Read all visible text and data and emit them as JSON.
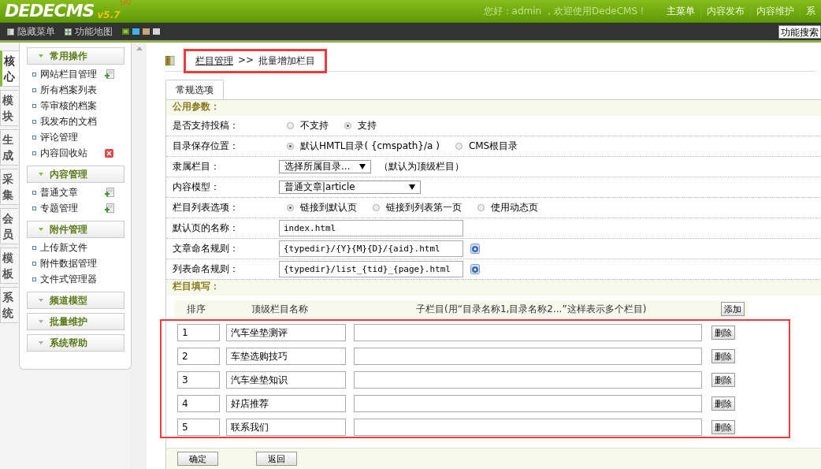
{
  "header": {
    "logo": "DEDECMS",
    "version": "v5.7",
    "edition": "SP2",
    "greeting": "您好：admin ，欢迎使用DedeCMS！",
    "menu": [
      {
        "label": "主菜单",
        "selected": true
      },
      {
        "label": "内容发布",
        "selected": false
      },
      {
        "label": "内容维护",
        "selected": false
      },
      {
        "label": "系",
        "selected": false
      }
    ]
  },
  "toolbar": {
    "items": [
      {
        "label": "隐藏菜单",
        "kind": "hide"
      },
      {
        "label": "功能地图",
        "kind": "map"
      }
    ],
    "skins": [
      {
        "color": "#8cc63f",
        "selected": true
      },
      {
        "color": "#3fb4e8",
        "selected": false
      },
      {
        "color": "#c4a77c",
        "selected": false
      },
      {
        "color": "#d2d4d8",
        "selected": false
      }
    ],
    "search_button": "功能搜索"
  },
  "side_tabs": [
    {
      "label": "核心",
      "selected": true
    },
    {
      "label": "模块",
      "selected": false
    },
    {
      "label": "生成",
      "selected": false
    },
    {
      "label": "采集",
      "selected": false
    },
    {
      "label": "会员",
      "selected": false
    },
    {
      "label": "模板",
      "selected": false
    },
    {
      "label": "系统",
      "selected": false
    }
  ],
  "menu_groups": [
    {
      "title": "常用操作",
      "expanded": true,
      "items": [
        {
          "label": "网站栏目管理",
          "kind": "add"
        },
        {
          "label": "所有档案列表",
          "kind": "plain"
        },
        {
          "label": "等审核的档案",
          "kind": "plain"
        },
        {
          "label": "我发布的文档",
          "kind": "plain"
        },
        {
          "label": "评论管理",
          "kind": "plain"
        },
        {
          "label": "内容回收站",
          "kind": "delete"
        }
      ]
    },
    {
      "title": "内容管理",
      "expanded": true,
      "items": [
        {
          "label": "普通文章",
          "kind": "add"
        },
        {
          "label": "专题管理",
          "kind": "add"
        }
      ]
    },
    {
      "title": "附件管理",
      "expanded": true,
      "items": [
        {
          "label": "上传新文件",
          "kind": "plain"
        },
        {
          "label": "附件数据管理",
          "kind": "plain"
        },
        {
          "label": "文件式管理器",
          "kind": "plain"
        }
      ]
    },
    {
      "title": "频道模型",
      "expanded": false
    },
    {
      "title": "批量维护",
      "expanded": false
    },
    {
      "title": "系统帮助",
      "expanded": false
    }
  ],
  "breadcrumb": {
    "link": "栏目管理",
    "separator": ">>",
    "current": "批量增加栏目",
    "highlighted": true
  },
  "tabs": [
    {
      "label": "常规选项",
      "selected": true
    }
  ],
  "common_heading": "公用参数：",
  "rows": [
    {
      "kind": "radio",
      "label": "是否支持投稿：",
      "options": [
        {
          "label": "不支持",
          "selected": false
        },
        {
          "label": "支持",
          "selected": true
        }
      ]
    },
    {
      "kind": "radio",
      "label": "目录保存位置：",
      "options": [
        {
          "label": "默认HMTL目录( {cmspath}/a )",
          "selected": true
        },
        {
          "label": "CMS根目录",
          "selected": false
        }
      ]
    },
    {
      "kind": "select",
      "label": "隶属栏目：",
      "value": "选择所属目录...",
      "note": "（默认为顶级栏目）"
    },
    {
      "kind": "select",
      "label": "内容模型：",
      "value": "普通文章|article"
    },
    {
      "kind": "radio",
      "label": "栏目列表选项：",
      "options": [
        {
          "label": "链接到默认页",
          "selected": true
        },
        {
          "label": "链接到列表第一页",
          "selected": false
        },
        {
          "label": "使用动态页",
          "selected": false
        }
      ]
    },
    {
      "kind": "text",
      "label": "默认页的名称：",
      "value": "index.html",
      "help": false
    },
    {
      "kind": "text",
      "label": "文章命名规则：",
      "value": "{typedir}/{Y}{M}{D}/{aid}.html",
      "help": true
    },
    {
      "kind": "text",
      "label": "列表命名规则：",
      "value": "{typedir}/list_{tid}_{page}.html",
      "help": true
    }
  ],
  "fill_heading": "栏目填写：",
  "batch_table": {
    "columns": [
      "排序",
      "顶级栏目名称",
      "子栏目(用“目录名称1,目录名称2...”这样表示多个栏目)"
    ],
    "add_button": "添加",
    "highlighted": true,
    "rows": [
      {
        "order": "1",
        "name": "汽车坐垫测评",
        "delete_button": "删除"
      },
      {
        "order": "2",
        "name": "车垫选购技巧",
        "delete_button": "删除"
      },
      {
        "order": "3",
        "name": "汽车坐垫知识",
        "delete_button": "删除"
      },
      {
        "order": "4",
        "name": "好店推荐",
        "delete_button": "删除"
      },
      {
        "order": "5",
        "name": "联系我们",
        "delete_button": "删除"
      }
    ]
  },
  "footer_buttons": [
    "确定",
    "返回"
  ]
}
